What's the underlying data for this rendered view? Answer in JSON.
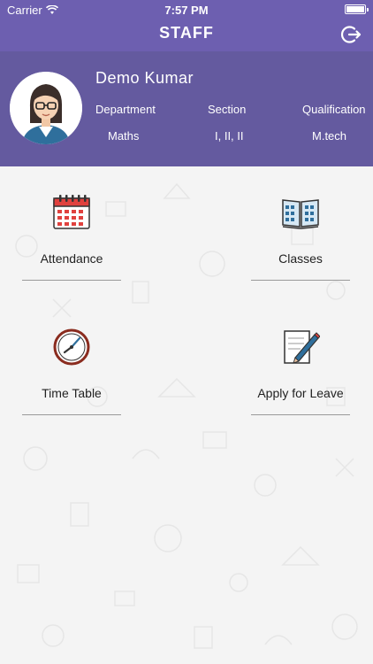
{
  "status": {
    "carrier": "Carrier",
    "time": "7:57 PM"
  },
  "nav": {
    "title": "STAFF",
    "logout_icon": "logout-icon"
  },
  "profile": {
    "name": "Demo Kumar",
    "department_label": "Department",
    "section_label": "Section",
    "qualification_label": "Qualification",
    "department": "Maths",
    "section": "I, II, II",
    "qualification": "M.tech"
  },
  "menu": [
    {
      "label": "Attendance",
      "icon": "calendar-icon"
    },
    {
      "label": "Classes",
      "icon": "book-icon"
    },
    {
      "label": "Time Table",
      "icon": "clock-icon"
    },
    {
      "label": "Apply for Leave",
      "icon": "document-pencil-icon"
    }
  ],
  "colors": {
    "header": "#6d5fb0",
    "profile_bg": "#645a9f",
    "background": "#f4f4f4"
  }
}
